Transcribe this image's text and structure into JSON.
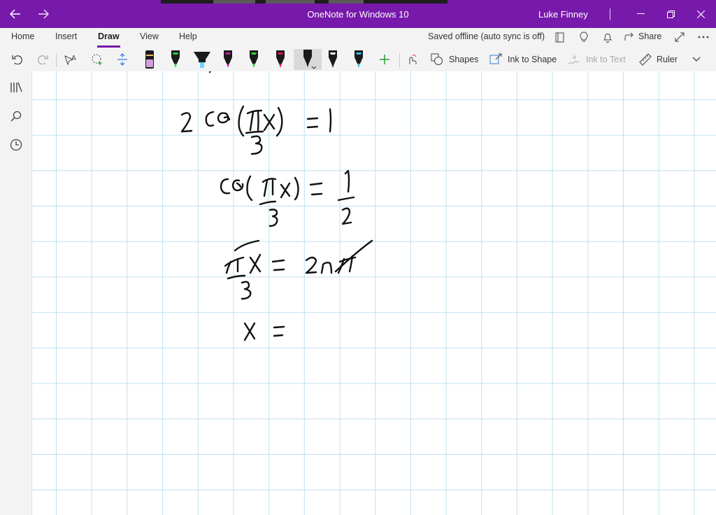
{
  "titlebar": {
    "title": "OneNote for Windows 10",
    "user": "Luke Finney",
    "back_icon": "back-arrow-icon",
    "forward_icon": "forward-arrow-icon"
  },
  "ribbon": {
    "tabs": [
      {
        "label": "Home"
      },
      {
        "label": "Insert"
      },
      {
        "label": "Draw",
        "active": true
      },
      {
        "label": "View"
      },
      {
        "label": "Help"
      }
    ],
    "status": "Saved offline (auto sync is off)",
    "share_label": "Share"
  },
  "toolbar": {
    "shapes_label": "Shapes",
    "ink_to_shape_label": "Ink to Shape",
    "ink_to_text_label": "Ink to Text",
    "ruler_label": "Ruler",
    "pens": [
      {
        "kind": "eraser",
        "color": "#d59de0"
      },
      {
        "kind": "pen",
        "color": "#2ecc40"
      },
      {
        "kind": "highlighter",
        "color": "#6cd6ff"
      },
      {
        "kind": "pen",
        "color": "#c020a0"
      },
      {
        "kind": "pen",
        "color": "#2ecc40"
      },
      {
        "kind": "pen",
        "color": "#e01060"
      },
      {
        "kind": "pen",
        "color": "#111111",
        "active": true
      },
      {
        "kind": "pen",
        "color": "#111111"
      },
      {
        "kind": "pen",
        "color": "#33bbee"
      }
    ]
  },
  "colors": {
    "accent": "#7719aa",
    "grid": "#bfe0ef",
    "ink": "#111111"
  }
}
